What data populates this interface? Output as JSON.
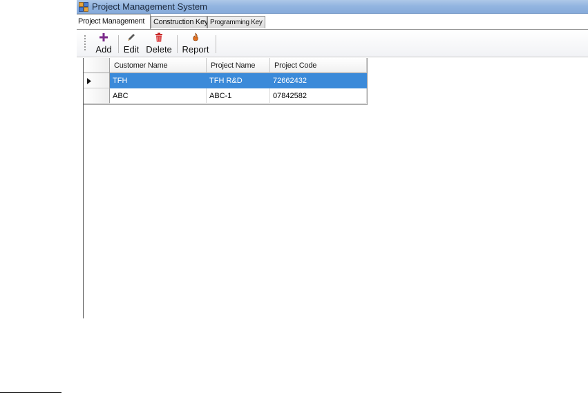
{
  "window": {
    "title": "Project Management System"
  },
  "tabs": [
    {
      "label": "Project Management",
      "active": true
    },
    {
      "label": "Construction Key",
      "active": false
    },
    {
      "label": "Programming Key",
      "active": false
    }
  ],
  "toolbar": {
    "add_label": "Add",
    "edit_label": "Edit",
    "delete_label": "Delete",
    "report_label": "Report",
    "icons": {
      "add": "plus-icon",
      "edit": "pencil-icon",
      "delete": "trash-icon",
      "report": "report-icon"
    }
  },
  "grid": {
    "columns": [
      "Customer Name",
      "Project Name",
      "Project Code"
    ],
    "rows": [
      {
        "customer": "TFH",
        "project": "TFH R&D",
        "code": "72662432",
        "selected": true
      },
      {
        "customer": "ABC",
        "project": "ABC-1",
        "code": "07842582",
        "selected": false
      }
    ]
  },
  "colors": {
    "title_bar": "#93b5e0",
    "selection": "#3b8ad9",
    "add_icon": "#7b2a8a",
    "delete_icon": "#c62828"
  }
}
